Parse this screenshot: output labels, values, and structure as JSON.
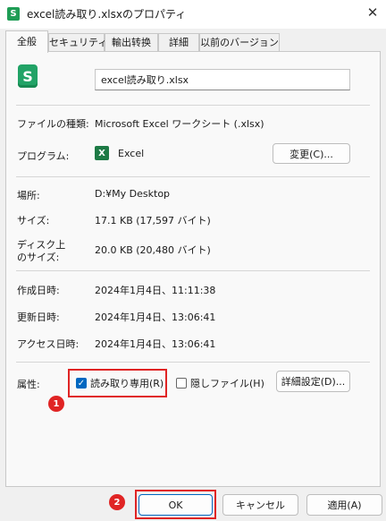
{
  "window": {
    "title": "excel読み取り.xlsxのプロパティ",
    "app_icon_glyph": "S",
    "close_glyph": "✕"
  },
  "tabs": [
    {
      "label": "全般",
      "active": true
    },
    {
      "label": "セキュリティ",
      "active": false
    },
    {
      "label": "輸出转换",
      "active": false
    },
    {
      "label": "詳細",
      "active": false
    },
    {
      "label": "以前のバージョン",
      "active": false
    }
  ],
  "file": {
    "icon_glyph": "S",
    "name": "excel読み取り.xlsx"
  },
  "properties": {
    "file_type_label": "ファイルの種類:",
    "file_type_value": "Microsoft Excel ワークシート (.xlsx)",
    "program_label": "プログラム:",
    "program_icon_glyph": "X",
    "program_value": "Excel",
    "change_button": "変更(C)...",
    "location_label": "場所:",
    "location_value": "D:¥My Desktop",
    "size_label": "サイズ:",
    "size_value": "17.1 KB (17,597 バイト)",
    "disk_size_label_1": "ディスク上",
    "disk_size_label_2": "のサイズ:",
    "disk_size_value": "20.0 KB (20,480 バイト)",
    "created_label": "作成日時:",
    "created_value": "2024年1月4日、11:11:38",
    "modified_label": "更新日時:",
    "modified_value": "2024年1月4日、13:06:41",
    "accessed_label": "アクセス日時:",
    "accessed_value": "2024年1月4日、13:06:41"
  },
  "attributes": {
    "label": "属性:",
    "readonly_label": "読み取り専用(R)",
    "readonly_checked": true,
    "hidden_label": "隠しファイル(H)",
    "hidden_checked": false,
    "advanced_button": "詳細設定(D)..."
  },
  "callouts": {
    "first": "1",
    "second": "2"
  },
  "footer": {
    "ok": "OK",
    "cancel": "キャンセル",
    "apply": "適用(A)"
  },
  "colors": {
    "callout": "#e02424",
    "checkbox_checked": "#0067c0",
    "excel_green": "#21a366"
  }
}
